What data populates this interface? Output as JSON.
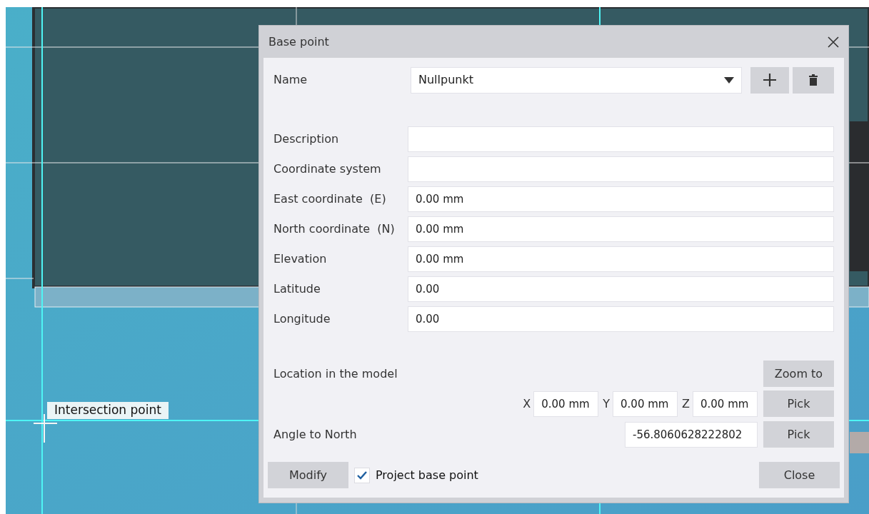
{
  "canvas": {
    "tooltip": "Intersection point"
  },
  "dialog": {
    "title": "Base point",
    "name_field": {
      "label": "Name",
      "value": "Nullpunkt"
    },
    "fields": [
      {
        "label": "Description"
      },
      {
        "label": "Coordinate system"
      },
      {
        "label": "East coordinate  (E)",
        "value": "0.00 mm"
      },
      {
        "label": "North coordinate  (N)",
        "value": "0.00 mm"
      },
      {
        "label": "Elevation",
        "value": "0.00 mm"
      },
      {
        "label": "Latitude",
        "value": "0.00"
      },
      {
        "label": "Longitude",
        "value": "0.00"
      }
    ],
    "location": {
      "label": "Location in the model",
      "zoom_button": "Zoom to",
      "pick_button": "Pick",
      "coords": [
        {
          "axis": "X",
          "value": "0.00 mm"
        },
        {
          "axis": "Y",
          "value": "0.00 mm"
        },
        {
          "axis": "Z",
          "value": "0.00 mm"
        }
      ]
    },
    "angle": {
      "label": "Angle to North",
      "value": "-56.8060628222802",
      "pick_button": "Pick"
    },
    "modify_button": "Modify",
    "project_base_point": {
      "label": "Project base point",
      "checked": true
    },
    "close_button": "Close"
  }
}
